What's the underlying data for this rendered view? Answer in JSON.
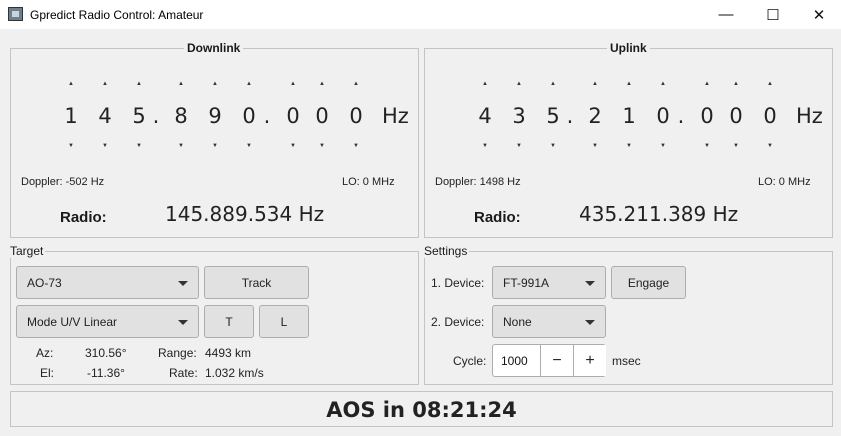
{
  "window": {
    "title": "Gpredict Radio Control: Amateur",
    "minimize": "—",
    "maximize": "☐",
    "close": "✕"
  },
  "downlink": {
    "title": "Downlink",
    "digits": [
      "1",
      "4",
      "5",
      ".",
      "8",
      "9",
      "0",
      ".",
      "0",
      "0",
      "0"
    ],
    "unit": "Hz",
    "doppler": "Doppler: -502 Hz",
    "lo": "LO: 0 MHz",
    "radio_label": "Radio:",
    "radio_freq": "145.889.534 Hz"
  },
  "uplink": {
    "title": "Uplink",
    "digits": [
      "4",
      "3",
      "5",
      ".",
      "2",
      "1",
      "0",
      ".",
      "0",
      "0",
      "0"
    ],
    "unit": "Hz",
    "doppler": "Doppler: 1498 Hz",
    "lo": "LO: 0 MHz",
    "radio_label": "Radio:",
    "radio_freq": "435.211.389 Hz"
  },
  "target": {
    "title": "Target",
    "satellite": "AO-73",
    "track_button": "Track",
    "mode": "Mode U/V Linear",
    "t_button": "T",
    "l_button": "L",
    "az_label": "Az:",
    "az_value": "310.56°",
    "el_label": "El:",
    "el_value": "-11.36°",
    "range_label": "Range:",
    "range_value": "4493 km",
    "rate_label": "Rate:",
    "rate_value": "1.032 km/s"
  },
  "settings": {
    "title": "Settings",
    "device1_label": "1. Device:",
    "device1_value": "FT-991A",
    "engage_button": "Engage",
    "device2_label": "2. Device:",
    "device2_value": "None",
    "cycle_label": "Cycle:",
    "cycle_value": "1000",
    "minus": "−",
    "plus": "+",
    "cycle_unit": "msec"
  },
  "status": {
    "aos": "AOS in 08:21:24"
  }
}
